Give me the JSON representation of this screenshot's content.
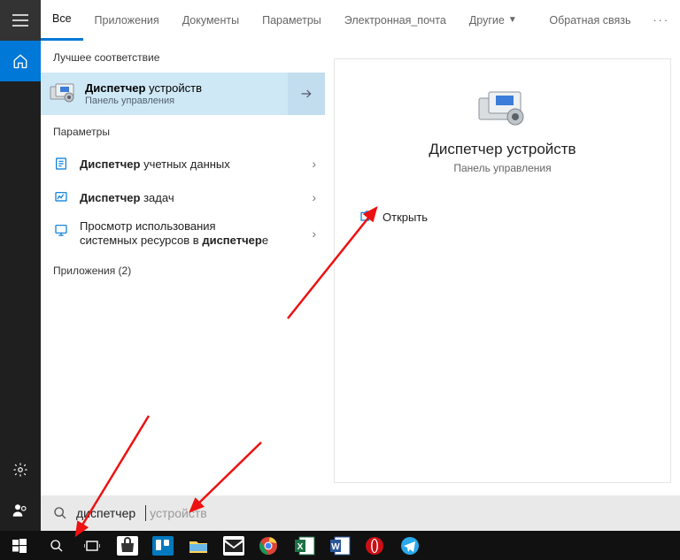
{
  "rail": {
    "menu": "menu",
    "home": "home",
    "settings": "settings",
    "account": "account"
  },
  "tabs": {
    "all": "Все",
    "apps": "Приложения",
    "docs": "Документы",
    "settings": "Параметры",
    "email": "Электронная_почта",
    "other": "Другие",
    "feedback": "Обратная связь",
    "more": "···"
  },
  "sections": {
    "best": "Лучшее соответствие",
    "settings": "Параметры",
    "apps_count_label": "Приложения (2)"
  },
  "best": {
    "title_bold": "Диспетчер",
    "title_rest": " устройств",
    "subtitle": "Панель управления"
  },
  "rows": [
    {
      "bold": "Диспетчер",
      "rest": " учетных данных"
    },
    {
      "bold": "Диспетчер",
      "rest": " задач"
    },
    {
      "line1": "Просмотр использования",
      "line2_pre": "системных ресурсов в ",
      "line2_bold": "диспетчер",
      "line2_post": "е"
    }
  ],
  "detail": {
    "title": "Диспетчер устройств",
    "subtitle": "Панель управления",
    "open": "Открыть"
  },
  "search": {
    "typed": "диспетчер",
    "hint": "устройств"
  },
  "taskbar": {
    "start": "start",
    "search": "search",
    "taskview": "taskview"
  }
}
